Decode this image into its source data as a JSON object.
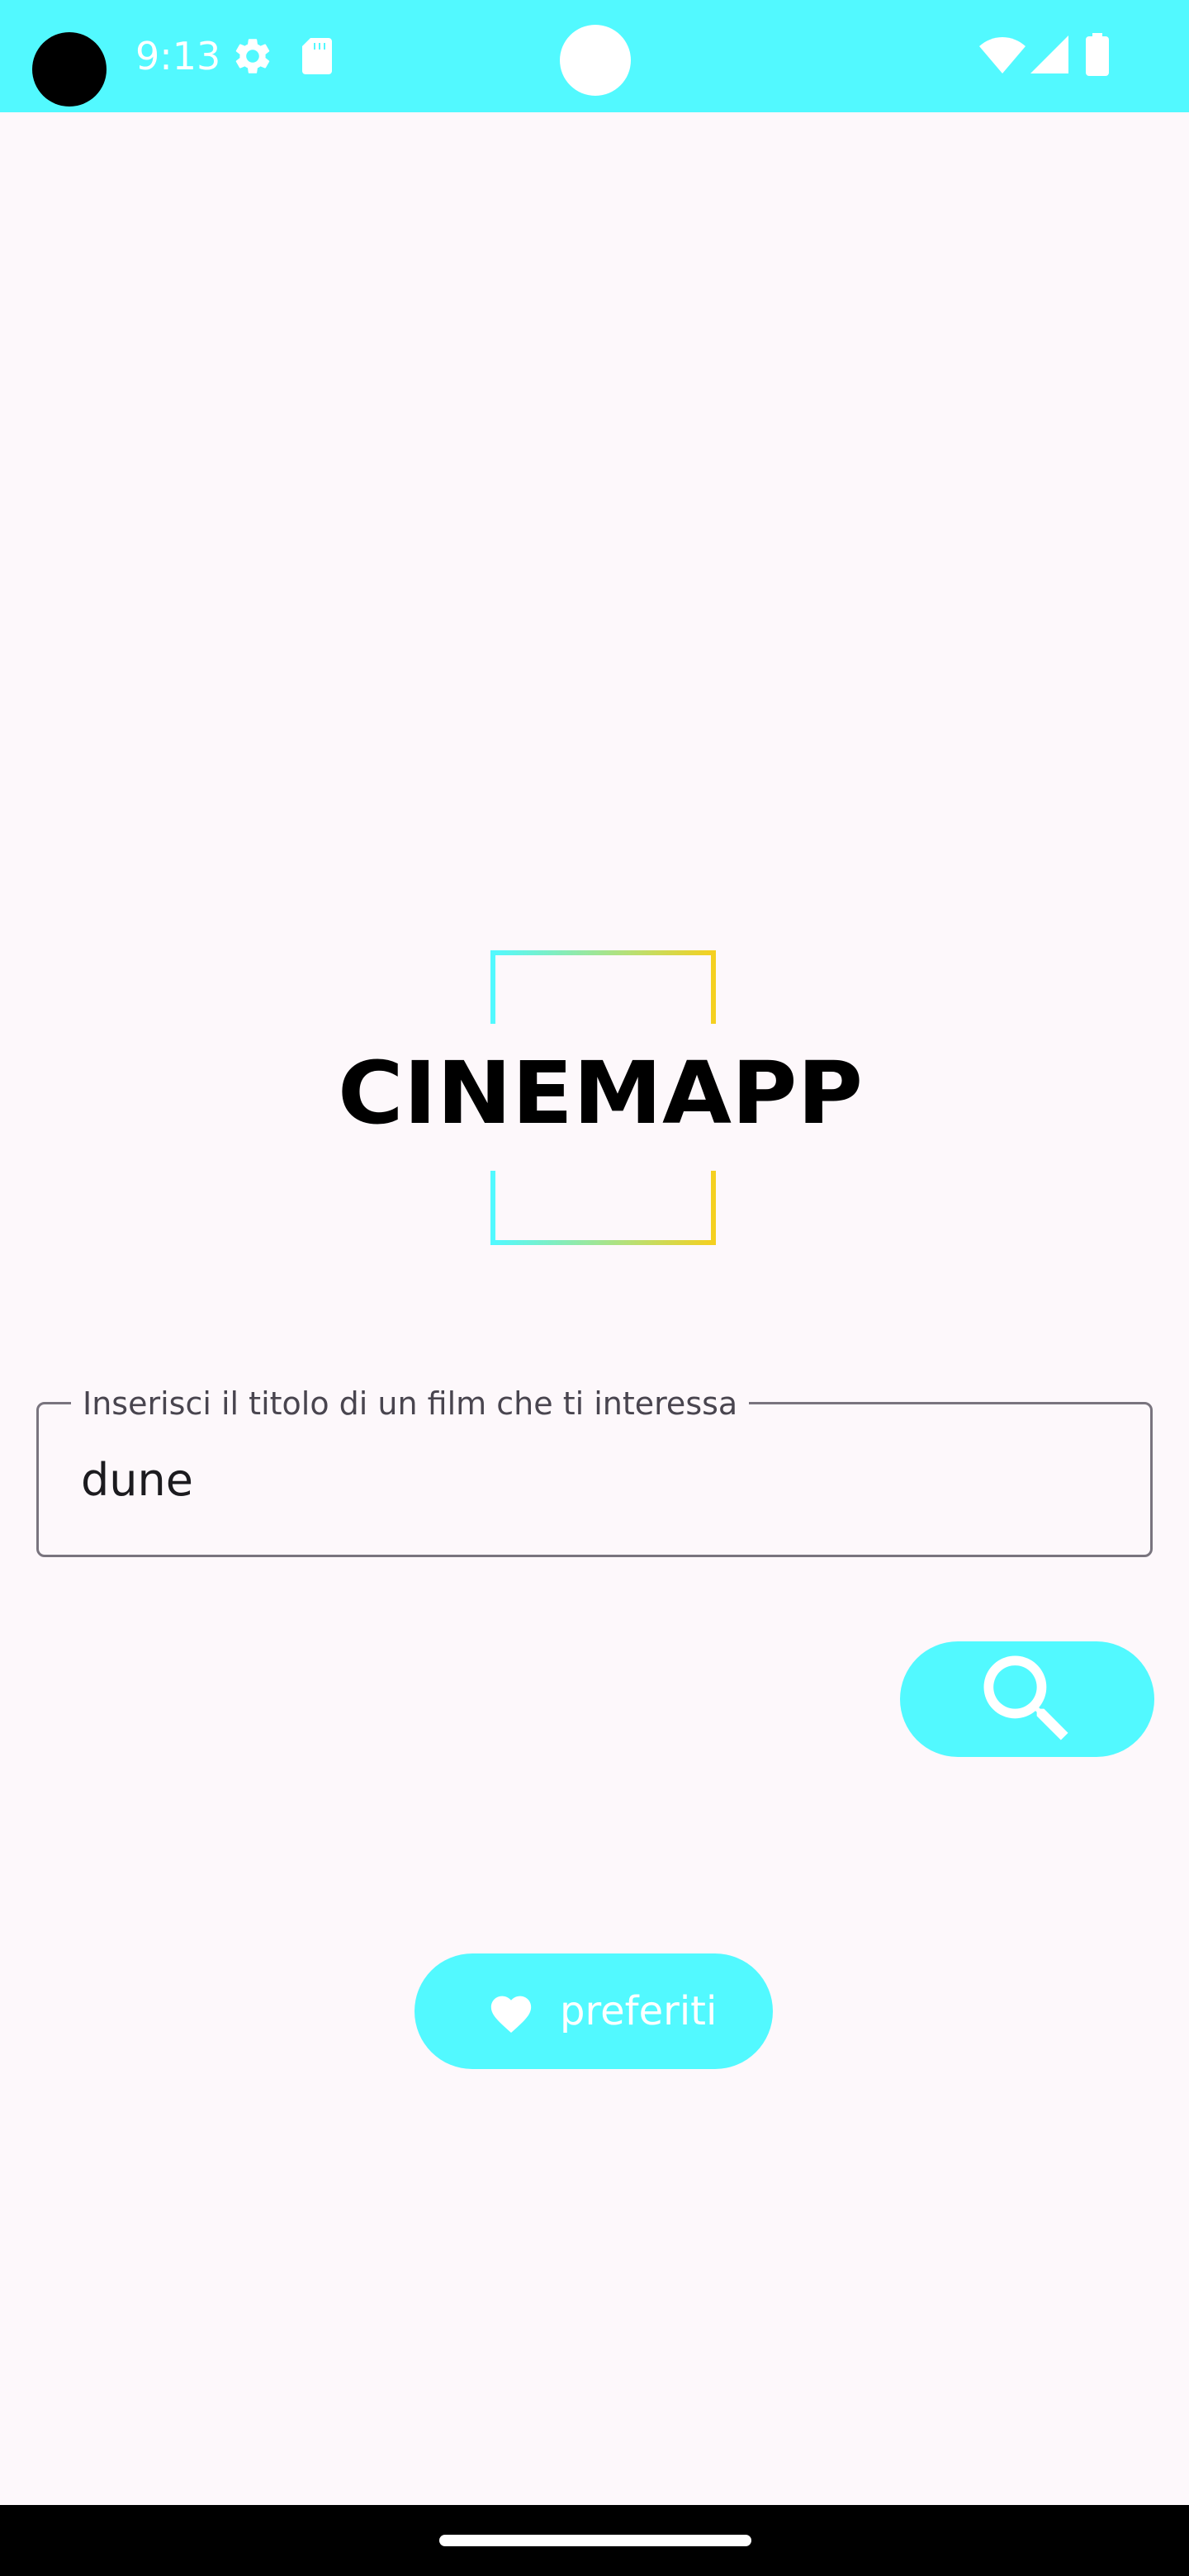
{
  "status_bar": {
    "time": "9:13",
    "icons": [
      "settings-gear-icon",
      "sd-card-icon",
      "wifi-icon",
      "signal-icon",
      "battery-icon"
    ],
    "background": "#52f9ff"
  },
  "logo": {
    "text": "CINEMAPP",
    "gradient_start": "#52f9ff",
    "gradient_end": "#f5d020"
  },
  "search": {
    "label": "Inserisci il titolo di un film che ti interessa",
    "value": "dune",
    "button_icon": "search-icon"
  },
  "favorites": {
    "label": "preferiti",
    "icon": "heart-icon"
  },
  "colors": {
    "accent": "#52f9ff",
    "background": "#fdf8fb",
    "outline": "#79747e"
  }
}
